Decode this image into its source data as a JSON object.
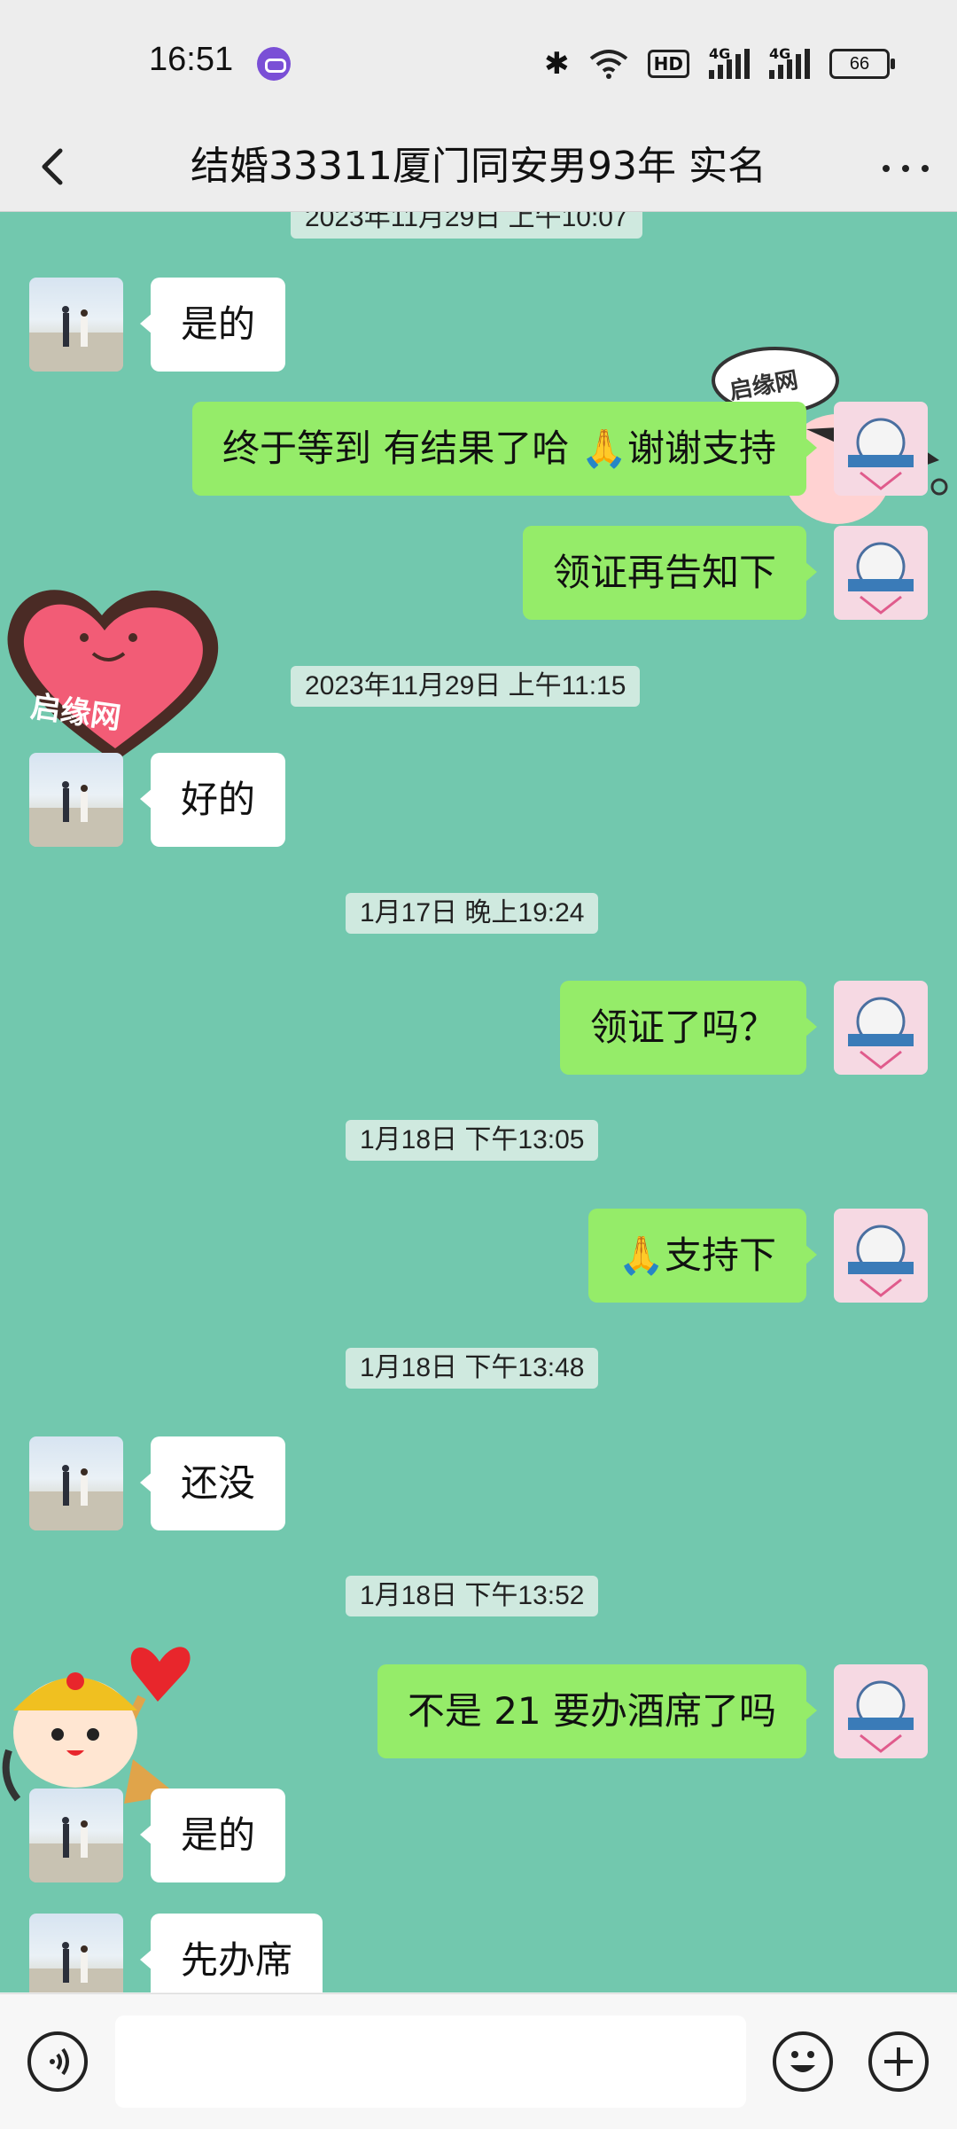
{
  "status_bar": {
    "time": "16:51",
    "battery": "66",
    "network_labels": [
      "4G",
      "4G"
    ],
    "hd_label": "HD"
  },
  "header": {
    "title": "结婚33311厦门同安男93年 实名"
  },
  "chat": {
    "background_color": "#72c8ae",
    "timestamps": [
      "2023年11月29日 上午10:07",
      "2023年11月29日 上午11:15",
      "1月17日 晚上19:24",
      "1月18日 下午13:05",
      "1月18日 下午13:48",
      "1月18日 下午13:52"
    ],
    "messages": [
      {
        "side": "in",
        "text": "是的"
      },
      {
        "side": "out",
        "text": "终于等到 有结果了哈 🙏谢谢支持"
      },
      {
        "side": "out",
        "text": "领证再告知下"
      },
      {
        "side": "in",
        "text": "好的"
      },
      {
        "side": "out",
        "text": "领证了吗？"
      },
      {
        "side": "out",
        "text": "🙏支持下"
      },
      {
        "side": "in",
        "text": "还没"
      },
      {
        "side": "out",
        "text": "不是 21 要办酒席了吗"
      },
      {
        "side": "in",
        "text": "是的"
      },
      {
        "side": "in",
        "text": "先办席"
      }
    ],
    "decorations": {
      "heart_sticker_text": "启缘网",
      "bubble_sticker_text": "启缘网"
    }
  },
  "input_bar": {
    "placeholder": "",
    "icons": [
      "voice-icon",
      "emoji-icon",
      "plus-icon"
    ]
  }
}
